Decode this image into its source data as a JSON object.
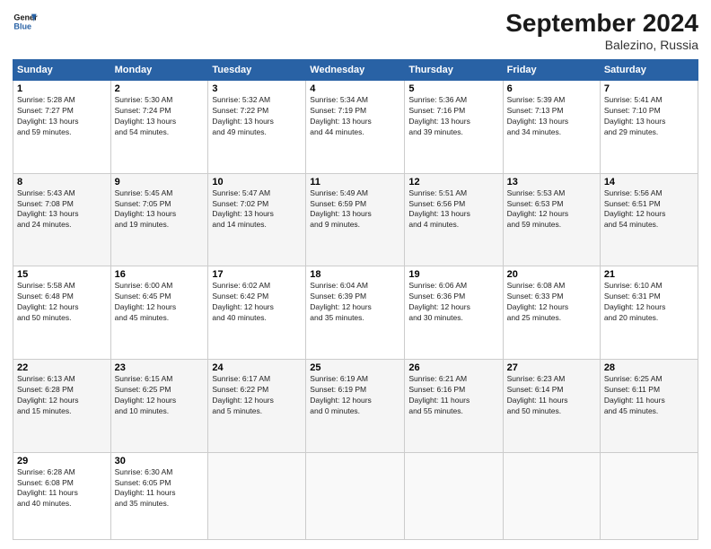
{
  "header": {
    "logo_line1": "General",
    "logo_line2": "Blue",
    "title": "September 2024",
    "subtitle": "Balezino, Russia"
  },
  "weekdays": [
    "Sunday",
    "Monday",
    "Tuesday",
    "Wednesday",
    "Thursday",
    "Friday",
    "Saturday"
  ],
  "weeks": [
    [
      {
        "day": "1",
        "info": "Sunrise: 5:28 AM\nSunset: 7:27 PM\nDaylight: 13 hours\nand 59 minutes."
      },
      {
        "day": "2",
        "info": "Sunrise: 5:30 AM\nSunset: 7:24 PM\nDaylight: 13 hours\nand 54 minutes."
      },
      {
        "day": "3",
        "info": "Sunrise: 5:32 AM\nSunset: 7:22 PM\nDaylight: 13 hours\nand 49 minutes."
      },
      {
        "day": "4",
        "info": "Sunrise: 5:34 AM\nSunset: 7:19 PM\nDaylight: 13 hours\nand 44 minutes."
      },
      {
        "day": "5",
        "info": "Sunrise: 5:36 AM\nSunset: 7:16 PM\nDaylight: 13 hours\nand 39 minutes."
      },
      {
        "day": "6",
        "info": "Sunrise: 5:39 AM\nSunset: 7:13 PM\nDaylight: 13 hours\nand 34 minutes."
      },
      {
        "day": "7",
        "info": "Sunrise: 5:41 AM\nSunset: 7:10 PM\nDaylight: 13 hours\nand 29 minutes."
      }
    ],
    [
      {
        "day": "8",
        "info": "Sunrise: 5:43 AM\nSunset: 7:08 PM\nDaylight: 13 hours\nand 24 minutes."
      },
      {
        "day": "9",
        "info": "Sunrise: 5:45 AM\nSunset: 7:05 PM\nDaylight: 13 hours\nand 19 minutes."
      },
      {
        "day": "10",
        "info": "Sunrise: 5:47 AM\nSunset: 7:02 PM\nDaylight: 13 hours\nand 14 minutes."
      },
      {
        "day": "11",
        "info": "Sunrise: 5:49 AM\nSunset: 6:59 PM\nDaylight: 13 hours\nand 9 minutes."
      },
      {
        "day": "12",
        "info": "Sunrise: 5:51 AM\nSunset: 6:56 PM\nDaylight: 13 hours\nand 4 minutes."
      },
      {
        "day": "13",
        "info": "Sunrise: 5:53 AM\nSunset: 6:53 PM\nDaylight: 12 hours\nand 59 minutes."
      },
      {
        "day": "14",
        "info": "Sunrise: 5:56 AM\nSunset: 6:51 PM\nDaylight: 12 hours\nand 54 minutes."
      }
    ],
    [
      {
        "day": "15",
        "info": "Sunrise: 5:58 AM\nSunset: 6:48 PM\nDaylight: 12 hours\nand 50 minutes."
      },
      {
        "day": "16",
        "info": "Sunrise: 6:00 AM\nSunset: 6:45 PM\nDaylight: 12 hours\nand 45 minutes."
      },
      {
        "day": "17",
        "info": "Sunrise: 6:02 AM\nSunset: 6:42 PM\nDaylight: 12 hours\nand 40 minutes."
      },
      {
        "day": "18",
        "info": "Sunrise: 6:04 AM\nSunset: 6:39 PM\nDaylight: 12 hours\nand 35 minutes."
      },
      {
        "day": "19",
        "info": "Sunrise: 6:06 AM\nSunset: 6:36 PM\nDaylight: 12 hours\nand 30 minutes."
      },
      {
        "day": "20",
        "info": "Sunrise: 6:08 AM\nSunset: 6:33 PM\nDaylight: 12 hours\nand 25 minutes."
      },
      {
        "day": "21",
        "info": "Sunrise: 6:10 AM\nSunset: 6:31 PM\nDaylight: 12 hours\nand 20 minutes."
      }
    ],
    [
      {
        "day": "22",
        "info": "Sunrise: 6:13 AM\nSunset: 6:28 PM\nDaylight: 12 hours\nand 15 minutes."
      },
      {
        "day": "23",
        "info": "Sunrise: 6:15 AM\nSunset: 6:25 PM\nDaylight: 12 hours\nand 10 minutes."
      },
      {
        "day": "24",
        "info": "Sunrise: 6:17 AM\nSunset: 6:22 PM\nDaylight: 12 hours\nand 5 minutes."
      },
      {
        "day": "25",
        "info": "Sunrise: 6:19 AM\nSunset: 6:19 PM\nDaylight: 12 hours\nand 0 minutes."
      },
      {
        "day": "26",
        "info": "Sunrise: 6:21 AM\nSunset: 6:16 PM\nDaylight: 11 hours\nand 55 minutes."
      },
      {
        "day": "27",
        "info": "Sunrise: 6:23 AM\nSunset: 6:14 PM\nDaylight: 11 hours\nand 50 minutes."
      },
      {
        "day": "28",
        "info": "Sunrise: 6:25 AM\nSunset: 6:11 PM\nDaylight: 11 hours\nand 45 minutes."
      }
    ],
    [
      {
        "day": "29",
        "info": "Sunrise: 6:28 AM\nSunset: 6:08 PM\nDaylight: 11 hours\nand 40 minutes."
      },
      {
        "day": "30",
        "info": "Sunrise: 6:30 AM\nSunset: 6:05 PM\nDaylight: 11 hours\nand 35 minutes."
      },
      {
        "day": "",
        "info": ""
      },
      {
        "day": "",
        "info": ""
      },
      {
        "day": "",
        "info": ""
      },
      {
        "day": "",
        "info": ""
      },
      {
        "day": "",
        "info": ""
      }
    ]
  ]
}
